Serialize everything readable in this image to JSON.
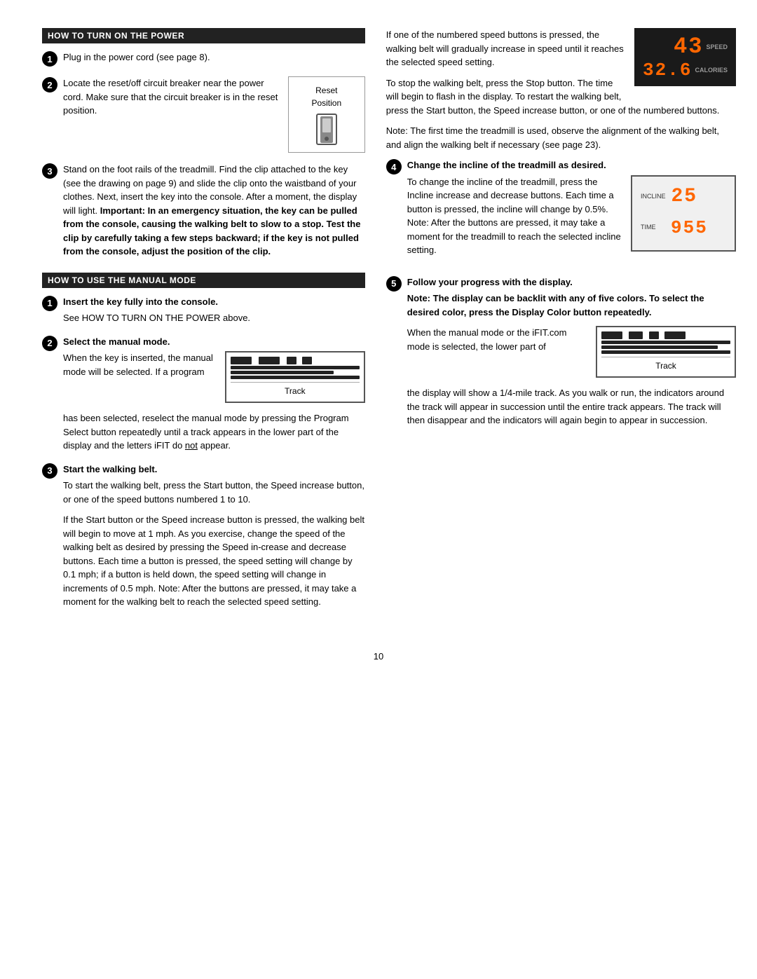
{
  "page": {
    "number": "10"
  },
  "left": {
    "section1": {
      "title": "HOW TO TURN ON THE POWER",
      "step1": {
        "text": "Plug in the power cord (see page 8)."
      },
      "step2": {
        "text_before": "Locate the reset/off circuit breaker near the power cord. Make sure that the circuit breaker is in the reset position.",
        "reset_label": "Reset\nPosition"
      },
      "step3": {
        "text": "Stand on the foot rails of the treadmill. Find the clip attached to the key (see the drawing on page 9) and slide the clip onto the waistband of your clothes. Next, insert the key into the console. After a moment, the display will light. ",
        "bold_text": "Important: In an emergency situation, the key can be pulled from the console, causing the walking belt to slow to a stop. Test the clip by carefully taking a few steps backward; if the key is not pulled from the console, adjust the position of the clip."
      }
    },
    "section2": {
      "title": "HOW TO USE THE MANUAL MODE",
      "step1": {
        "label": "Insert the key fully into the console.",
        "text": "See HOW TO TURN ON THE POWER above."
      },
      "step2": {
        "label": "Select the manual mode.",
        "text_before": "When the key is inserted, the manual mode will be selected. If a program",
        "track_label": "Track",
        "text_after": "has been selected, reselect the manual mode by pressing the Program Select button repeatedly until a track appears in the lower part of the display and the letters iFIT do ",
        "not": "not",
        "text_end": " appear."
      },
      "step3": {
        "label": "Start the walking belt.",
        "para1": "To start the walking belt, press the Start button, the Speed increase button, or one of the speed buttons numbered 1 to 10.",
        "para2": "If the Start button or the Speed increase button is pressed, the walking belt will begin to move at 1 mph. As you exercise, change the speed of the walking belt as desired by pressing the Speed in-crease and decrease buttons. Each time a button is pressed, the speed setting will change by 0.1 mph; if a button is held down, the speed setting will change in increments of 0.5 mph. Note: After the buttons are pressed, it may take a moment for the walking belt to reach the selected speed setting."
      }
    }
  },
  "right": {
    "display": {
      "speed_num": "43",
      "speed_label": "SPEED",
      "calories_num": "32.6",
      "calories_label": "CALORIES"
    },
    "para1": "If one of the numbered speed buttons is pressed, the walking belt will gradually increase in speed until it reaches the selected speed setting.",
    "para2": "To stop the walking belt, press the Stop button. The time will begin to flash in the display. To restart the walking belt, press the Start button, the Speed increase button, or one of the numbered buttons.",
    "para3": "Note: The first time the treadmill is used, observe the alignment of the walking belt, and align the walking belt if necessary (see page 23).",
    "step4": {
      "label": "Change the incline of the treadmill as desired.",
      "text": "To change the incline of the treadmill, press the Incline increase and decrease buttons. Each time a button is pressed, the incline will change by 0.5%. Note: After the buttons are pressed, it may take a moment for the treadmill to reach the selected incline setting.",
      "incline_num": "25",
      "incline_label": "INCLINE",
      "time_num": "955",
      "time_label": "TIME"
    },
    "step5": {
      "label": "Follow your progress with the display.",
      "bold_text": "Note: The display can be backlit with any of five colors. To select the desired color, press the Display Color button repeatedly.",
      "text_before": "When the manual mode or the iFIT.com mode is selected, the lower part of",
      "track_label": "Track",
      "text_after": "the display will show a 1/4-mile track. As you walk or run, the indicators around the track will appear in succession until the entire track appears. The track will then disappear and the indicators will again begin to appear in succession."
    }
  }
}
